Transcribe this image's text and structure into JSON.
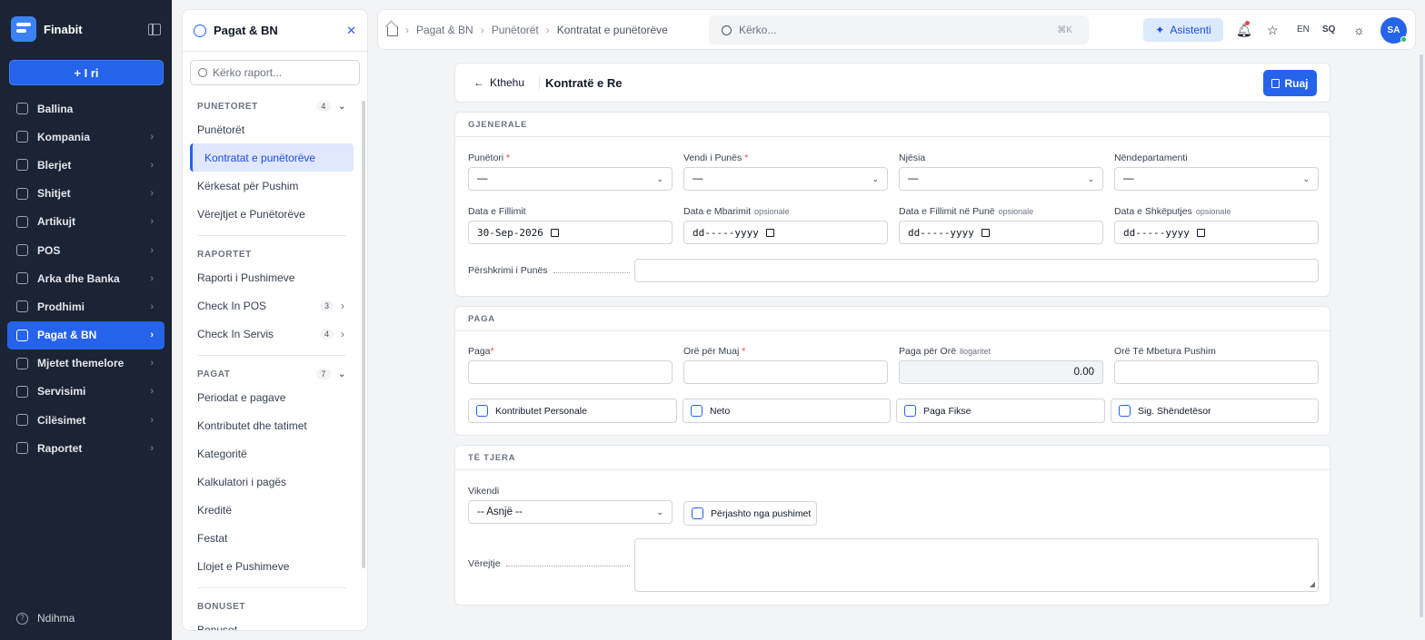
{
  "app": {
    "name": "Finabit",
    "new_label": "+ I ri",
    "help_label": "Ndihma"
  },
  "sidebar": {
    "items": [
      {
        "label": "Ballina",
        "icon": "dashboard-icon",
        "active": false
      },
      {
        "label": "Kompania",
        "icon": "building-icon",
        "active": false
      },
      {
        "label": "Blerjet",
        "icon": "truck-icon",
        "active": false
      },
      {
        "label": "Shitjet",
        "icon": "cart-icon",
        "active": false
      },
      {
        "label": "Artikujt",
        "icon": "box-icon",
        "active": false
      },
      {
        "label": "POS",
        "icon": "store-icon",
        "active": false
      },
      {
        "label": "Arka dhe Banka",
        "icon": "wallet-icon",
        "active": false
      },
      {
        "label": "Prodhimi",
        "icon": "factory-icon",
        "active": false
      },
      {
        "label": "Pagat & BN",
        "icon": "link-icon",
        "active": true
      },
      {
        "label": "Mjetet themelore",
        "icon": "tools-icon",
        "active": false
      },
      {
        "label": "Servisimi",
        "icon": "wrench-icon",
        "active": false
      },
      {
        "label": "Cilësimet",
        "icon": "gear-icon",
        "active": false
      },
      {
        "label": "Raportet",
        "icon": "chart-icon",
        "active": false
      }
    ]
  },
  "subsidebar": {
    "title": "Pagat & BN",
    "search_placeholder": "Kërko raport...",
    "sections": {
      "punetoret": {
        "title": "PUNETORET",
        "count": "4",
        "items": [
          "Punëtorët",
          "Kontratat e punëtorëve",
          "Kërkesat për Pushim",
          "Vërejtjet e Punëtorëve"
        ]
      },
      "raportet": {
        "title": "RAPORTET",
        "items": [
          "Raporti i Pushimeve",
          "Check In POS",
          "Check In Servis"
        ],
        "counts": [
          "",
          "3",
          "4"
        ]
      },
      "pagat": {
        "title": "PAGAT",
        "count": "7",
        "items": [
          "Periodat e pagave",
          "Kontributet dhe tatimet",
          "Kategoritë",
          "Kalkulatori i pagës",
          "Kreditë",
          "Festat",
          "Llojet e Pushimeve"
        ]
      },
      "bonuset": {
        "title": "BONUSET",
        "items": [
          "Bonuset"
        ]
      }
    }
  },
  "header": {
    "breadcrumb": [
      "Pagat & BN",
      "Punëtorët",
      "Kontratat e punëtorëve"
    ],
    "search_placeholder": "Kërko...",
    "search_shortcut": "⌘K",
    "assistant_label": "Asistenti",
    "lang_en": "EN",
    "lang_sq": "SQ",
    "avatar_initials": "SA"
  },
  "form": {
    "back_label": "Kthehu",
    "title": "Kontratë e Re",
    "save_label": "Ruaj",
    "general": {
      "section": "GJENERALE",
      "punetori": {
        "label": "Punëtori",
        "value": "—"
      },
      "vendi": {
        "label": "Vendi i Punës",
        "value": "—"
      },
      "njesia": {
        "label": "Njësia",
        "value": "—"
      },
      "nendep": {
        "label": "Nëndepartamenti",
        "value": "—"
      },
      "data_fillimit": {
        "label": "Data e Fillimit",
        "value": "30-Sep-2026"
      },
      "data_mbarimit": {
        "label": "Data e Mbarimit",
        "optional": "opsionale",
        "value": "dd-----yyyy"
      },
      "data_fillimit_pune": {
        "label": "Data e Fillimit në Punë",
        "optional": "opsionale",
        "value": "dd-----yyyy"
      },
      "data_shkeputjes": {
        "label": "Data e Shkëputjes",
        "optional": "opsionale",
        "value": "dd-----yyyy"
      },
      "pershkrimi": {
        "label": "Përshkrimi i Punës",
        "value": ""
      }
    },
    "paga": {
      "section": "PAGA",
      "paga": {
        "label": "Paga",
        "value": ""
      },
      "ore_muaj": {
        "label": "Orë për Muaj",
        "value": ""
      },
      "paga_ore": {
        "label": "Paga për Orë",
        "note": "llogaritet",
        "value": "0.00"
      },
      "ore_pushim": {
        "label": "Orë Të Mbetura Pushim",
        "value": ""
      },
      "checks": [
        "Kontributet Personale",
        "Neto",
        "Paga Fikse",
        "Sig. Shëndetësor"
      ]
    },
    "tjera": {
      "section": "TË TJERA",
      "vikendi": {
        "label": "Vikendi",
        "value": "-- Asnjë --"
      },
      "perjashto": "Përjashto nga pushimet",
      "verejtje": {
        "label": "Vërejtje",
        "value": ""
      }
    }
  },
  "colors": {
    "accent": "#2563eb",
    "sidebar_bg": "#1b2434",
    "required": "#ef4444"
  }
}
